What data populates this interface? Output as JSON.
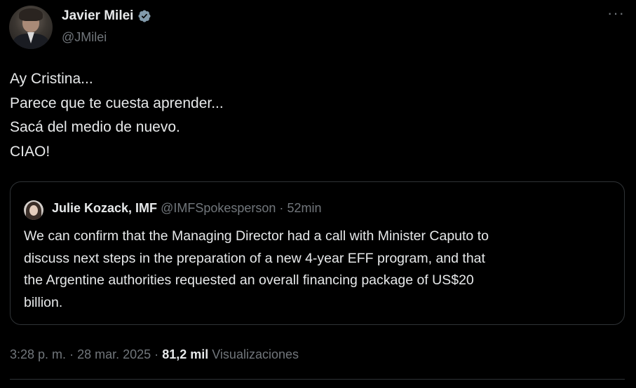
{
  "author": {
    "name": "Javier Milei",
    "handle": "@JMilei",
    "verified_color": "#829aab"
  },
  "tweet": {
    "lines": [
      "Ay Cristina...",
      "Parece que te cuesta aprender...",
      "Sacá del medio de nuevo.",
      "CIAO!"
    ]
  },
  "quote": {
    "name": "Julie Kozack, IMF",
    "handle": "@IMFSpokesperson",
    "separator": "·",
    "time": "52min",
    "lines": [
      "We can confirm that the Managing Director had a call with Minister Caputo to",
      "discuss next steps in the preparation of a new 4-year EFF program, and that",
      "the Argentine authorities requested an overall financing package of US$20",
      "billion."
    ]
  },
  "meta": {
    "time": "3:28 p. m.",
    "sep1": "·",
    "date": "28 mar. 2025",
    "sep2": "·",
    "views_count": "81,2 mil",
    "views_label": "Visualizaciones"
  },
  "icons": {
    "more": "more-icon",
    "verified": "verified-badge-icon"
  },
  "colors": {
    "background": "#000000",
    "text": "#e7e9ea",
    "secondary": "#71767b",
    "border": "#2f3336"
  }
}
